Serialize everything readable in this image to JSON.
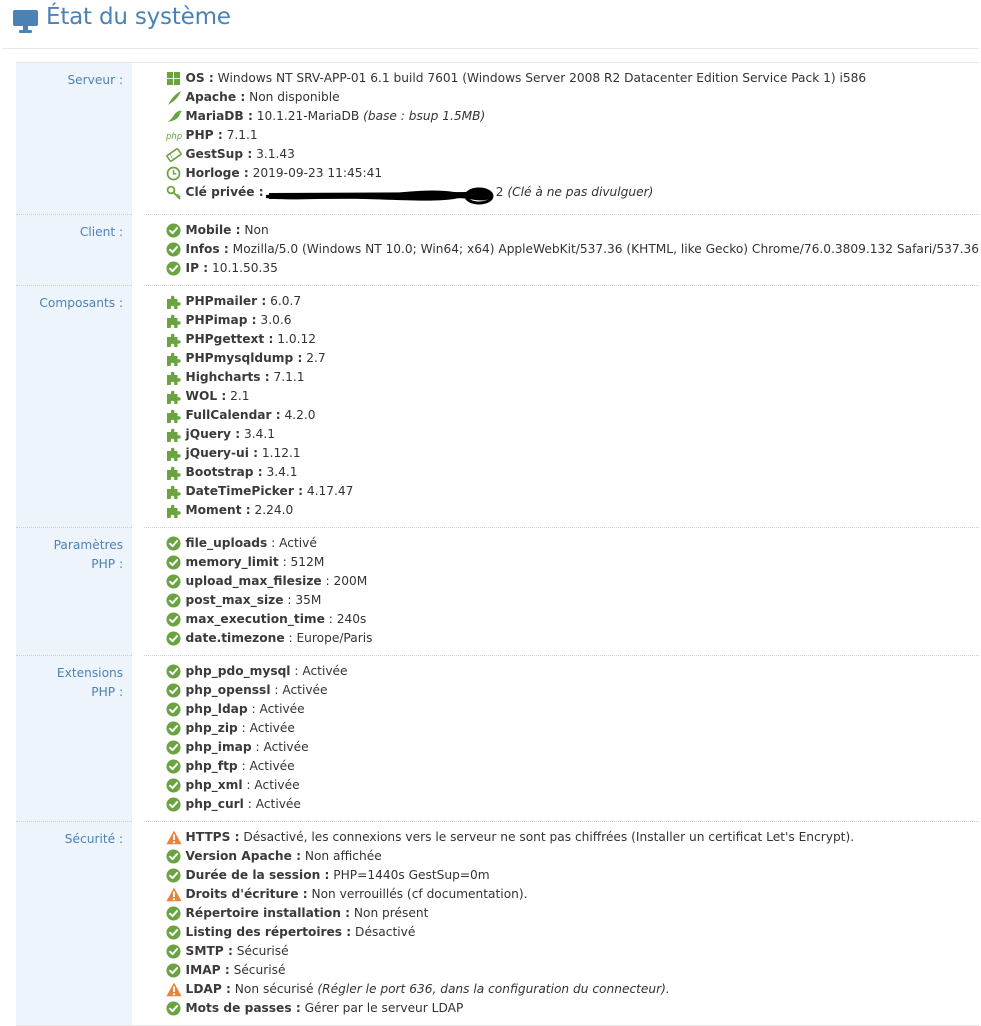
{
  "page": {
    "title": "État du système"
  },
  "server": {
    "label": "Serveur :",
    "items": [
      {
        "key": "OS :",
        "value": " Windows NT SRV-APP-01 6.1 build 7601 (Windows Server 2008 R2 Datacenter Edition Service Pack 1) i586",
        "icon": "windows-icon"
      },
      {
        "key": "Apache :",
        "value": " Non disponible",
        "icon": "apache-feather-icon"
      },
      {
        "key": "MariaDB :",
        "value": " 10.1.21-MariaDB ",
        "note": "(base : bsup 1.5MB)",
        "icon": "mariadb-seal-icon"
      },
      {
        "key": "PHP :",
        "value": " 7.1.1",
        "icon": "php-icon"
      },
      {
        "key": "GestSup :",
        "value": " 3.1.43",
        "icon": "ticket-icon"
      },
      {
        "key": "Horloge :",
        "value": " 2019-09-23 11:45:41",
        "icon": "clock-icon"
      },
      {
        "key": "Clé privée :",
        "value": "",
        "tail": "2",
        "note": " (Clé à ne pas divulguer)",
        "icon": "key-icon"
      }
    ]
  },
  "client": {
    "label": "Client :",
    "items": [
      {
        "key": "Mobile :",
        "value": " Non"
      },
      {
        "key": "Infos :",
        "value": " Mozilla/5.0 (Windows NT 10.0; Win64; x64) AppleWebKit/537.36 (KHTML, like Gecko) Chrome/76.0.3809.132 Safari/537.36"
      },
      {
        "key": "IP :",
        "value": " 10.1.50.35"
      }
    ]
  },
  "components": {
    "label": "Composants :",
    "items": [
      {
        "key": "PHPmailer :",
        "value": " 6.0.7"
      },
      {
        "key": "PHPimap :",
        "value": " 3.0.6"
      },
      {
        "key": "PHPgettext :",
        "value": " 1.0.12"
      },
      {
        "key": "PHPmysqldump :",
        "value": " 2.7"
      },
      {
        "key": "Highcharts :",
        "value": " 7.1.1"
      },
      {
        "key": "WOL :",
        "value": " 2.1"
      },
      {
        "key": "FullCalendar :",
        "value": " 4.2.0"
      },
      {
        "key": "jQuery :",
        "value": " 3.4.1"
      },
      {
        "key": "jQuery-ui :",
        "value": " 1.12.1"
      },
      {
        "key": "Bootstrap :",
        "value": " 3.4.1"
      },
      {
        "key": "DateTimePicker :",
        "value": " 4.17.47"
      },
      {
        "key": "Moment :",
        "value": " 2.24.0"
      }
    ]
  },
  "php_params": {
    "label_1": "Paramètres",
    "label_2": "PHP :",
    "items": [
      {
        "key": "file_uploads",
        "value": " : Activé"
      },
      {
        "key": "memory_limit",
        "value": " : 512M"
      },
      {
        "key": "upload_max_filesize",
        "value": " : 200M"
      },
      {
        "key": "post_max_size",
        "value": " : 35M"
      },
      {
        "key": "max_execution_time",
        "value": " : 240s"
      },
      {
        "key": "date.timezone",
        "value": " : Europe/Paris"
      }
    ]
  },
  "php_ext": {
    "label_1": "Extensions",
    "label_2": "PHP :",
    "items": [
      {
        "key": "php_pdo_mysql",
        "value": " : Activée"
      },
      {
        "key": "php_openssl",
        "value": " : Activée"
      },
      {
        "key": "php_ldap",
        "value": " : Activée"
      },
      {
        "key": "php_zip",
        "value": " : Activée"
      },
      {
        "key": "php_imap",
        "value": " : Activée"
      },
      {
        "key": "php_ftp",
        "value": " : Activée"
      },
      {
        "key": "php_xml",
        "value": " : Activée"
      },
      {
        "key": "php_curl",
        "value": " : Activée"
      }
    ]
  },
  "security": {
    "label": "Sécurité :",
    "items": [
      {
        "status": "warn",
        "key": "HTTPS :",
        "value": " Désactivé, les connexions vers le serveur ne sont pas chiffrées (",
        "link": "Installer un certificat Let's Encrypt",
        "after": ")."
      },
      {
        "status": "ok",
        "key": "Version Apache :",
        "value": " Non affichée"
      },
      {
        "status": "ok",
        "key": "Durée de la session :",
        "value": " PHP=1440s GestSup=0m"
      },
      {
        "status": "warn",
        "key": "Droits d'écriture :",
        "value": " Non verrouillés (",
        "link": "cf documentation",
        "after": ")."
      },
      {
        "status": "ok",
        "key": "Répertoire installation :",
        "value": " Non présent"
      },
      {
        "status": "ok",
        "key": "Listing des répertoires :",
        "value": " Désactivé"
      },
      {
        "status": "ok",
        "key": "SMTP :",
        "value": " Sécurisé"
      },
      {
        "status": "ok",
        "key": "IMAP :",
        "value": " Sécurisé"
      },
      {
        "status": "warn",
        "key": "LDAP :",
        "value": " Non sécurisé ",
        "note": "(Régler le port 636, dans la configuration du connecteur)."
      },
      {
        "status": "ok",
        "key": "Mots de passes :",
        "value": " Gérer par le serveur LDAP"
      }
    ]
  },
  "colors": {
    "accent": "#4b82b5",
    "ok": "#6aa33f",
    "warn": "#e8833a",
    "label_bg": "#eef4fb",
    "puzzle": "#6aa33f"
  }
}
